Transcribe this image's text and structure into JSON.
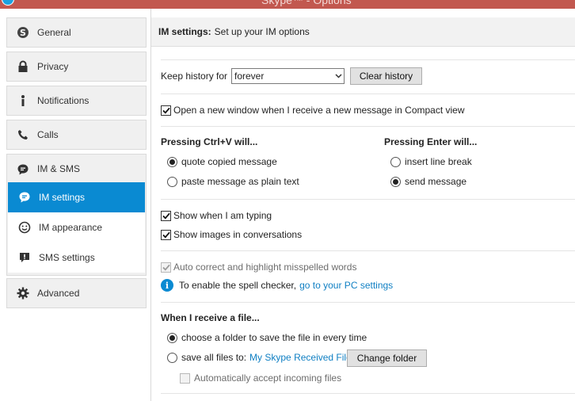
{
  "window": {
    "title": "Skype™ - Options"
  },
  "nav": {
    "general": "General",
    "privacy": "Privacy",
    "notifications": "Notifications",
    "calls": "Calls",
    "im_sms": "IM & SMS",
    "im_settings": "IM settings",
    "im_appearance": "IM appearance",
    "sms_settings": "SMS settings",
    "advanced": "Advanced"
  },
  "header": {
    "title": "IM settings:",
    "subtitle": "Set up your IM options"
  },
  "history": {
    "label": "Keep history for",
    "selected": "forever",
    "clear_button": "Clear history"
  },
  "compact_view": {
    "label": "Open a new window when I receive a new message in Compact view",
    "checked": true
  },
  "ctrl_v": {
    "heading": "Pressing Ctrl+V will...",
    "options": [
      "quote copied message",
      "paste message as plain text"
    ],
    "selected": "quote copied message"
  },
  "enter": {
    "heading": "Pressing Enter will...",
    "options": [
      "insert line break",
      "send message"
    ],
    "selected": "send message"
  },
  "typing": {
    "label": "Show when I am typing",
    "checked": true
  },
  "images": {
    "label": "Show images in conversations",
    "checked": true
  },
  "autocorrect": {
    "label": "Auto correct and highlight misspelled words",
    "checked": true,
    "disabled": true
  },
  "spell": {
    "text": "To enable the spell checker,",
    "link": "go to your PC settings"
  },
  "file": {
    "heading": "When I receive a file...",
    "choose_label": "choose a folder to save the file in every time",
    "save_label": "save all files to:",
    "folder_link": "My Skype Received Files",
    "change_button": "Change folder",
    "auto_accept_label": "Automatically accept incoming files",
    "selected": "choose"
  },
  "colors": {
    "accent": "#0a8ad2",
    "titlebar": "#c2584f",
    "link": "#0f7fc3"
  }
}
